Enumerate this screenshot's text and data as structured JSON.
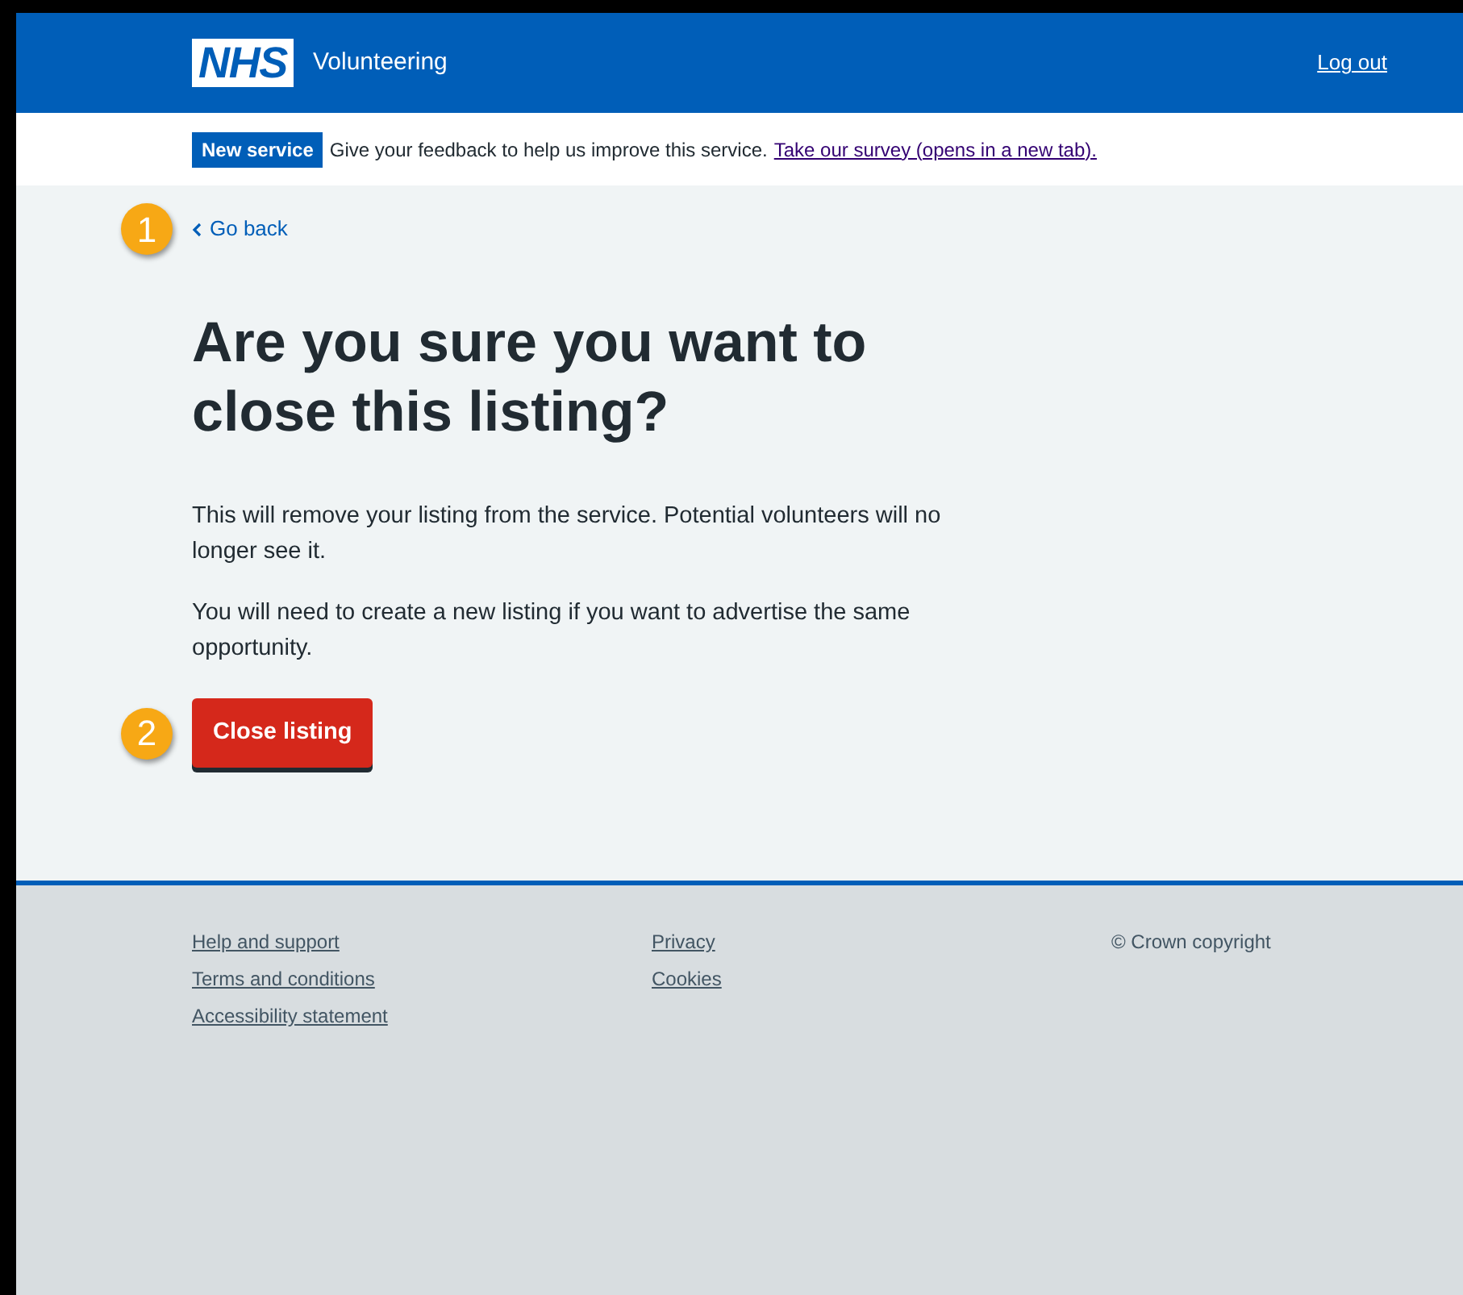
{
  "header": {
    "logo": "NHS",
    "service_name": "Volunteering",
    "logout_link": "Log out"
  },
  "banner": {
    "tag": "New service",
    "text": "Give your feedback to help us improve this service.",
    "link": "Take our survey (opens in a new tab)."
  },
  "back_link": {
    "label": "Go back",
    "callout": "1"
  },
  "heading": "Are you sure you want to close this listing?",
  "paragraphs": [
    "This will remove your listing from the service. Potential volunteers will no longer see it.",
    "You will need to create a new listing if you want to advertise the same opportunity."
  ],
  "button": {
    "label": "Close listing",
    "callout": "2"
  },
  "footer": {
    "columns": [
      [
        "Help and support",
        "Terms and conditions",
        "Accessibility statement"
      ],
      [
        "Privacy",
        "Cookies"
      ]
    ],
    "copyright": "© Crown copyright"
  }
}
